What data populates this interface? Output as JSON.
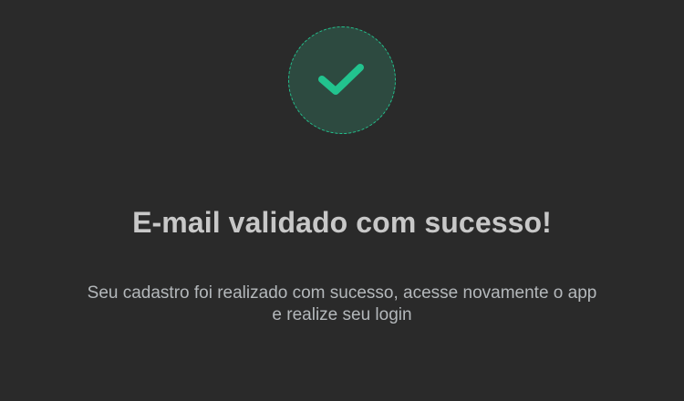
{
  "status": {
    "icon": "check-icon",
    "accent_color": "#22c38e",
    "badge_fill": "#2d4a40"
  },
  "content": {
    "title": "E-mail validado com sucesso!",
    "message_line_1": "Seu cadastro foi realizado com sucesso, acesse novamente o app",
    "message_line_2": "e realize seu login"
  }
}
